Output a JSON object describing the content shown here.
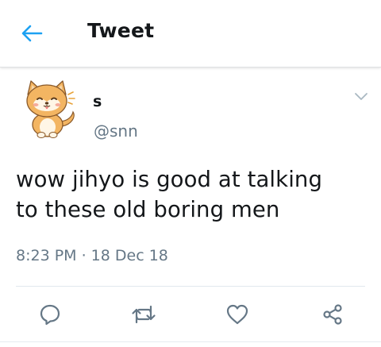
{
  "header": {
    "title": "Tweet",
    "back_icon": "back-arrow-icon",
    "accent_color": "#1da1f2"
  },
  "tweet": {
    "display_name": "s",
    "handle": "@snn",
    "avatar": "shiba-dog-sticker",
    "text_line1": "wow jihyo is good at talking",
    "text_line2": "to these old boring men",
    "timestamp": "8:23 PM · 18 Dec 18",
    "menu_icon": "chevron-down-icon"
  },
  "actions": [
    {
      "name": "reply",
      "icon": "reply-icon"
    },
    {
      "name": "retweet",
      "icon": "retweet-icon"
    },
    {
      "name": "like",
      "icon": "heart-icon"
    },
    {
      "name": "share",
      "icon": "share-icon"
    }
  ],
  "colors": {
    "text_primary": "#14171a",
    "text_secondary": "#657786",
    "icon_gray": "#657786",
    "divider": "#e1e8ed"
  }
}
